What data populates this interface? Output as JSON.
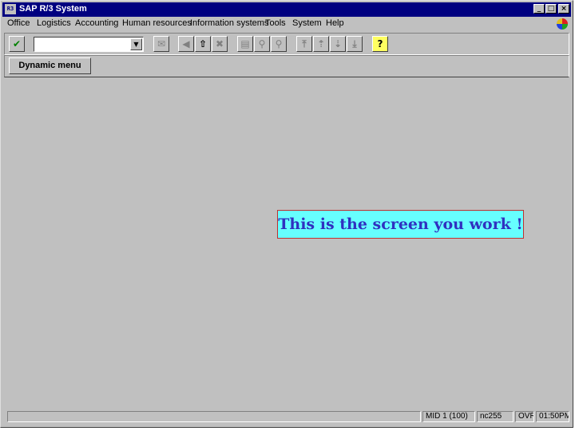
{
  "window": {
    "title": "SAP R/3 System",
    "title_icon": "R3"
  },
  "title_buttons": {
    "minimize": "_",
    "maximize": "□",
    "close": "×"
  },
  "menu": [
    "Office",
    "Logistics",
    "Accounting",
    "Human resources",
    "Information systems",
    "Tools",
    "System",
    "Help"
  ],
  "toolbar": {
    "enter_icon": "✔",
    "command_value": "",
    "dropdown_icon": "▼",
    "icons": {
      "save": "✉",
      "back": "◀",
      "exit": "⇧",
      "cancel": "✖",
      "print": "▤",
      "find": "⚲",
      "find_next": "⚲",
      "first_page": "⤒",
      "prev_page": "⇡",
      "next_page": "⇣",
      "last_page": "⤓",
      "help": "?"
    }
  },
  "app_toolbar": {
    "dynamic_menu_label": "Dynamic menu"
  },
  "callout": {
    "text": "This is the screen you work !"
  },
  "status": {
    "message": "",
    "system": "MID 1 (100)",
    "server": "nc255",
    "mode": "OVR",
    "time": "01:50PM"
  },
  "colors": {
    "titlebar": "#000080",
    "window": "#c0c0c0",
    "callout_bg": "#66ffff",
    "callout_text": "#3030c0",
    "callout_border": "#c03030"
  }
}
